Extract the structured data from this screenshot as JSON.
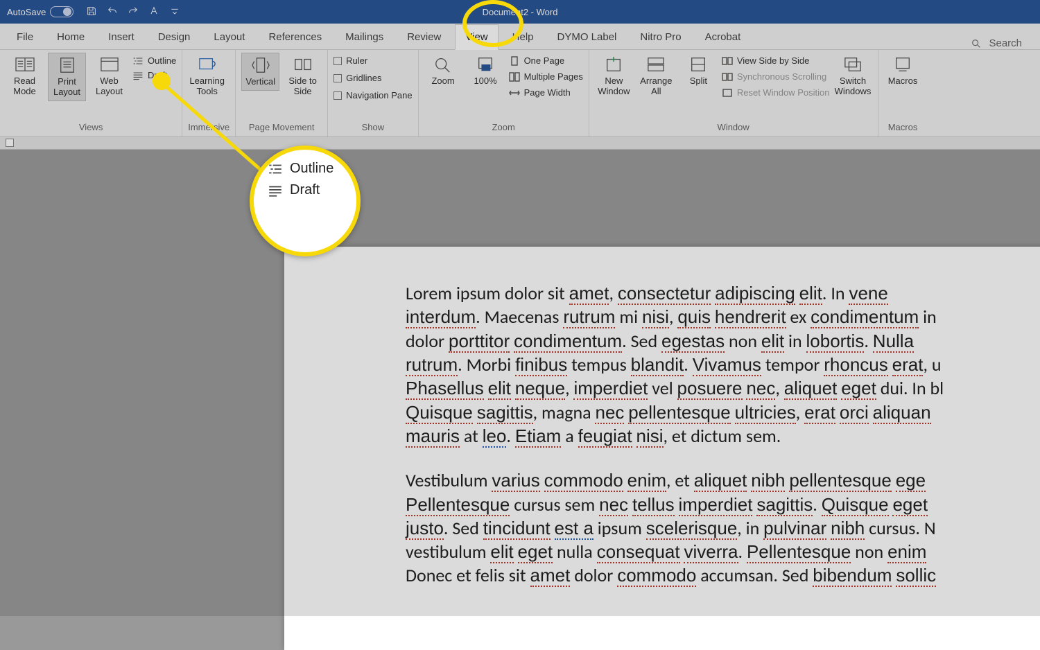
{
  "titlebar": {
    "autosave": "AutoSave",
    "doc_title": "Document2 - Word"
  },
  "tabs": [
    "File",
    "Home",
    "Insert",
    "Design",
    "Layout",
    "References",
    "Mailings",
    "Review",
    "View",
    "Help",
    "DYMO Label",
    "Nitro Pro",
    "Acrobat"
  ],
  "active_tab": "View",
  "search_placeholder": "Search",
  "ribbon": {
    "views": {
      "label": "Views",
      "read_mode": "Read Mode",
      "print_layout": "Print Layout",
      "web_layout": "Web Layout",
      "outline": "Outline",
      "draft": "Draft"
    },
    "immersive": {
      "label": "Immersive",
      "learning_tools": "Learning Tools"
    },
    "page_movement": {
      "label": "Page Movement",
      "vertical": "Vertical",
      "side": "Side to Side"
    },
    "show": {
      "label": "Show",
      "ruler": "Ruler",
      "gridlines": "Gridlines",
      "nav": "Navigation Pane"
    },
    "zoom": {
      "label": "Zoom",
      "zoom": "Zoom",
      "hundred": "100%",
      "one_page": "One Page",
      "multi": "Multiple Pages",
      "pagew": "Page Width"
    },
    "window": {
      "label": "Window",
      "neww": "New Window",
      "arrange": "Arrange All",
      "split": "Split",
      "side_by_side": "View Side by Side",
      "sync": "Synchronous Scrolling",
      "reset": "Reset Window Position",
      "switch": "Switch Windows"
    },
    "macros": {
      "label": "Macros",
      "macros": "Macros"
    }
  },
  "callout": {
    "outline": "Outline",
    "draft": "Draft"
  },
  "document": {
    "para1_plain": "Lorem ipsum dolor sit amet, consectetur adipiscing elit. In vene\ninterdum. Maecenas rutrum mi nisi, quis hendrerit ex condimentum in\ndolor porttitor condimentum. Sed egestas non elit in lobortis. Nulla\nrutrum. Morbi finibus tempus blandit. Vivamus tempor rhoncus erat, u\nPhasellus elit neque, imperdiet vel posuere nec, aliquet eget dui. In bl\nQuisque sagittis, magna nec pellentesque ultricies, erat orci aliquan\nmauris at leo. Etiam a feugiat nisi, et dictum sem.",
    "para2_plain": "Vestibulum varius commodo enim, et aliquet nibh pellentesque ege\nPellentesque cursus sem nec tellus imperdiet sagittis. Quisque eget\njusto. Sed tincidunt est a ipsum scelerisque, in pulvinar nibh cursus. N\nvestibulum elit eget nulla consequat viverra. Pellentesque non enim\nDonec et felis sit amet dolor commodo accumsan. Sed bibendum sollic"
  }
}
